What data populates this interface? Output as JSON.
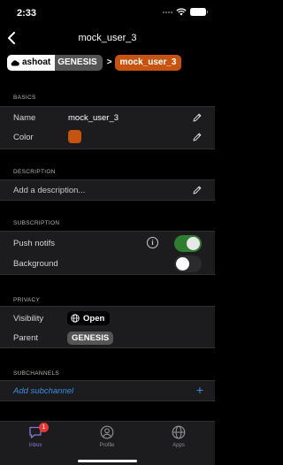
{
  "status_bar": {
    "time": "2:33"
  },
  "nav": {
    "title": "mock_user_3"
  },
  "ancestry": {
    "community": "ashoat",
    "parent": "GENESIS",
    "arrow": ">",
    "current": "mock_user_3"
  },
  "sections": {
    "basics": {
      "header": "BASICS",
      "name_label": "Name",
      "name_value": "mock_user_3",
      "color_label": "Color",
      "color_value": "#c65310"
    },
    "description": {
      "header": "DESCRIPTION",
      "placeholder": "Add a description..."
    },
    "subscription": {
      "header": "SUBSCRIPTION",
      "push_label": "Push notifs",
      "push_on": true,
      "background_label": "Background",
      "background_on": false
    },
    "privacy": {
      "header": "PRIVACY",
      "visibility_label": "Visibility",
      "visibility_value": "Open",
      "parent_label": "Parent",
      "parent_value": "GENESIS"
    },
    "subchannels": {
      "header": "SUBCHANNELS",
      "add_label": "Add subchannel",
      "add_icon": "+"
    }
  },
  "tabs": [
    {
      "label": "Inbox",
      "icon": "chat-bubble-icon",
      "badge": "1",
      "active": true
    },
    {
      "label": "Profile",
      "icon": "user-circle-icon",
      "active": false
    },
    {
      "label": "Apps",
      "icon": "globe-icon",
      "active": false
    }
  ],
  "colors": {
    "accent": "#c65310",
    "toggle_on": "#2e7d32",
    "link": "#3a8ee6",
    "active_tab": "#8a78d8"
  }
}
